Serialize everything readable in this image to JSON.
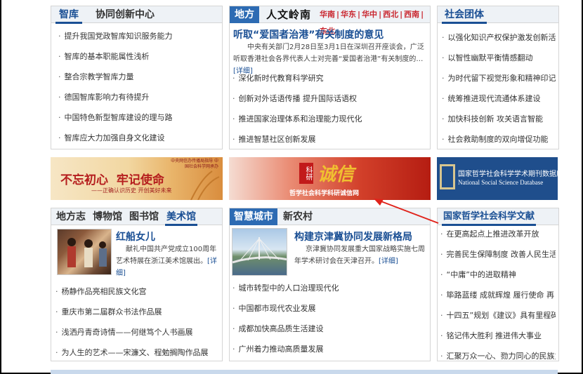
{
  "think_tank": {
    "tabs": [
      "智库",
      "协同创新中心"
    ],
    "items": [
      "提升我国党政智库知识服务能力",
      "智库的基本职能属性浅析",
      "整合宗教学智库力量",
      "德国智库影响力有待提升",
      "中国特色新型智库建设的理与路",
      "智库应大力加强自身文化建设"
    ]
  },
  "local": {
    "tab": "地方",
    "brand": "人文岭南",
    "regions": [
      "华南",
      "华东",
      "华中",
      "西北",
      "西南",
      "东北"
    ],
    "headline": "听取“爱国者治港”有关制度的意见",
    "summary": "中央有关部门2月28日至3月1日在深圳召开座谈会，广泛听取香港社会各界代表人士对完善“爱国者治港”有关制度的…",
    "more": "[详细]",
    "items": [
      "深化新时代教育科学研究",
      "创新对外话语传播 提升国际话语权",
      "推进国家治理体系和治理能力现代化",
      "推进智慧社区创新发展"
    ]
  },
  "social_groups": {
    "tab": "社会团体",
    "items": [
      "以强化知识产权保护激发创新活力",
      "以智性幽默平衡情感翻动",
      "为时代留下视觉形象和精神印记",
      "统筹推进现代流通体系建设",
      "加快科技创新 攻关语言智能",
      "社会救助制度的双向增促功能"
    ]
  },
  "banners": {
    "left": {
      "top_text": "中央网信办传播局指导 中国社会科学网承办",
      "main_text": "不忘初心  牢记使命",
      "sub_text": "——正确认识历史 开创美好未来"
    },
    "middle": {
      "seal_text": "科研",
      "calligraphy": "诚信",
      "caption": "哲学社会科学科研诚信网"
    },
    "right": {
      "title": "国家哲学社会科学学术期刊数据库",
      "subtitle": "National Social Science Database"
    }
  },
  "culture": {
    "tabs": [
      "地方志",
      "博物馆",
      "图书馆",
      "美术馆"
    ],
    "feature_title": "红船女儿",
    "feature_text": "献礼中国共产党成立100周年艺术特展在浙江美术馆展出。",
    "more": "[详细]",
    "items": [
      "杨静作品亮相民族文化宫",
      "重庆市第二届群众书法作品展",
      "浅洒丹青奇诗情——何继笃个人书画展",
      "为人生的艺术——宋濂文、程勉搁陶作品展"
    ]
  },
  "smart_city": {
    "tabs": [
      "智慧城市",
      "新农村"
    ],
    "headline": "构建京津冀协同发展新格局",
    "summary": "京津冀协同发展重大国家战略实施七周年学术研讨会在天津召开。",
    "more": "[详细]",
    "items": [
      "城市转型中的人口治理现代化",
      "中国都市现代农业发展",
      "成都加快高品质生活建设",
      "广州着力推动高质量发展"
    ]
  },
  "nssd": {
    "tab": "国家哲学社会科学文献",
    "items": [
      "在更高起点上推进改革开放",
      "完善民生保障制度 改善人民生活",
      "“中庸”中的进取精神",
      "筚路蓝缕 成就辉煌 履行使命 再",
      "十四五”规划《建议》具有里程碑",
      "铭记伟大胜利 推进伟大事业",
      "汇聚万众一心、勠力同心的民族力"
    ]
  },
  "colors": {
    "accent_blue": "#2d6bb3",
    "link_blue": "#1a4f94",
    "region_red": "#c9252e",
    "annotation_red": "#e0231b"
  }
}
